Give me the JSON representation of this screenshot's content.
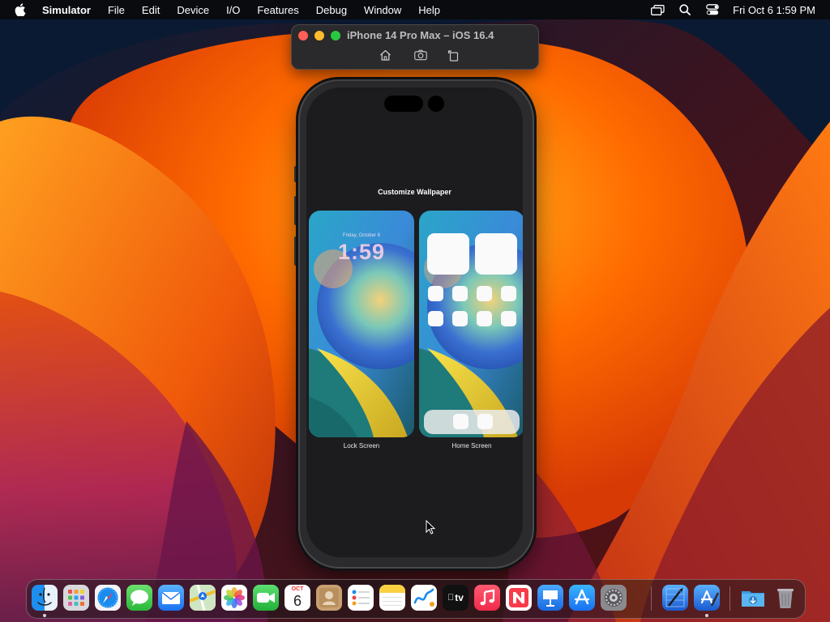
{
  "menubar": {
    "app_name": "Simulator",
    "items": [
      "File",
      "Edit",
      "Device",
      "I/O",
      "Features",
      "Debug",
      "Window",
      "Help"
    ],
    "clock": "Fri Oct 6  1:59 PM",
    "status_icons": [
      "display-mirroring-icon",
      "spotlight-search-icon",
      "control-center-icon"
    ]
  },
  "simulator": {
    "window_title": "iPhone 14 Pro Max – iOS 16.4",
    "toolbar_buttons": [
      "home-icon",
      "screenshot-icon",
      "rotate-icon"
    ],
    "traffic_lights": {
      "close": "#ff5f57",
      "minimize": "#febc2e",
      "zoom": "#28c840"
    }
  },
  "screen": {
    "title": "Customize Wallpaper",
    "lock_preview": {
      "label": "Lock Screen",
      "date": "Friday, October 6",
      "time": "1:59"
    },
    "home_preview": {
      "label": "Home Screen"
    }
  },
  "dock": {
    "apps": [
      "Finder",
      "Launchpad",
      "Safari",
      "Messages",
      "Mail",
      "Maps",
      "Photos",
      "FaceTime",
      "Calendar",
      "Contacts",
      "Reminders",
      "Notes",
      "Freeform",
      "TV",
      "Music",
      "News",
      "Keynote",
      "App Store",
      "System Settings",
      "Instruments",
      "Xcode",
      "Downloads",
      "Trash"
    ],
    "calendar": {
      "month": "OCT",
      "day": "6"
    },
    "tv_label": "tv"
  },
  "colors": {
    "wallpaper_orange": "#ff6a00",
    "wallpaper_navy": "#0b1a33",
    "screen_bg": "#1c1c1e"
  }
}
